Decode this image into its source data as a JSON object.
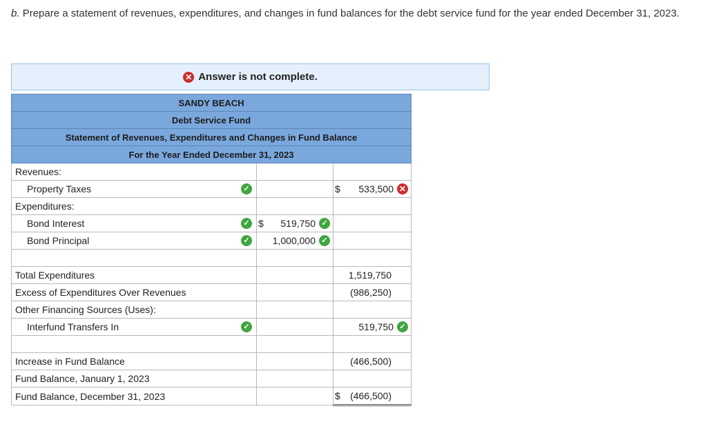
{
  "question": {
    "part_letter": "b.",
    "text": "Prepare a statement of revenues, expenditures, and changes in fund balances for the debt service fund for the year ended December 31, 2023."
  },
  "banner": {
    "text": "Answer is not complete."
  },
  "statement": {
    "headers": [
      "SANDY BEACH",
      "Debt Service Fund",
      "Statement of Revenues, Expenditures and Changes in Fund Balance",
      "For the Year Ended December 31, 2023"
    ],
    "rows": {
      "revenues_label": "Revenues:",
      "property_taxes": {
        "label": "Property Taxes",
        "dollar": "$",
        "value": "533,500"
      },
      "expenditures_label": "Expenditures:",
      "bond_interest": {
        "label": "Bond Interest",
        "dollar": "$",
        "value": "519,750"
      },
      "bond_principal": {
        "label": "Bond Principal",
        "value": "1,000,000"
      },
      "total_expenditures": {
        "label": "Total Expenditures",
        "value": "1,519,750"
      },
      "excess": {
        "label": "Excess of Expenditures Over Revenues",
        "value": "(986,250)"
      },
      "other_financing_label": "Other Financing Sources (Uses):",
      "interfund": {
        "label": "Interfund Transfers In",
        "value": "519,750"
      },
      "increase": {
        "label": "Increase in Fund Balance",
        "value": "(466,500)"
      },
      "fund_balance_jan": {
        "label": "Fund Balance, January 1, 2023"
      },
      "fund_balance_dec": {
        "label": "Fund Balance, December 31, 2023",
        "dollar": "$",
        "value": "(466,500)"
      }
    }
  },
  "colors": {
    "header_bg": "#7aa8dd",
    "banner_bg": "#e4f0fb",
    "correct": "#3fa640",
    "incorrect": "#cc2c2c"
  }
}
